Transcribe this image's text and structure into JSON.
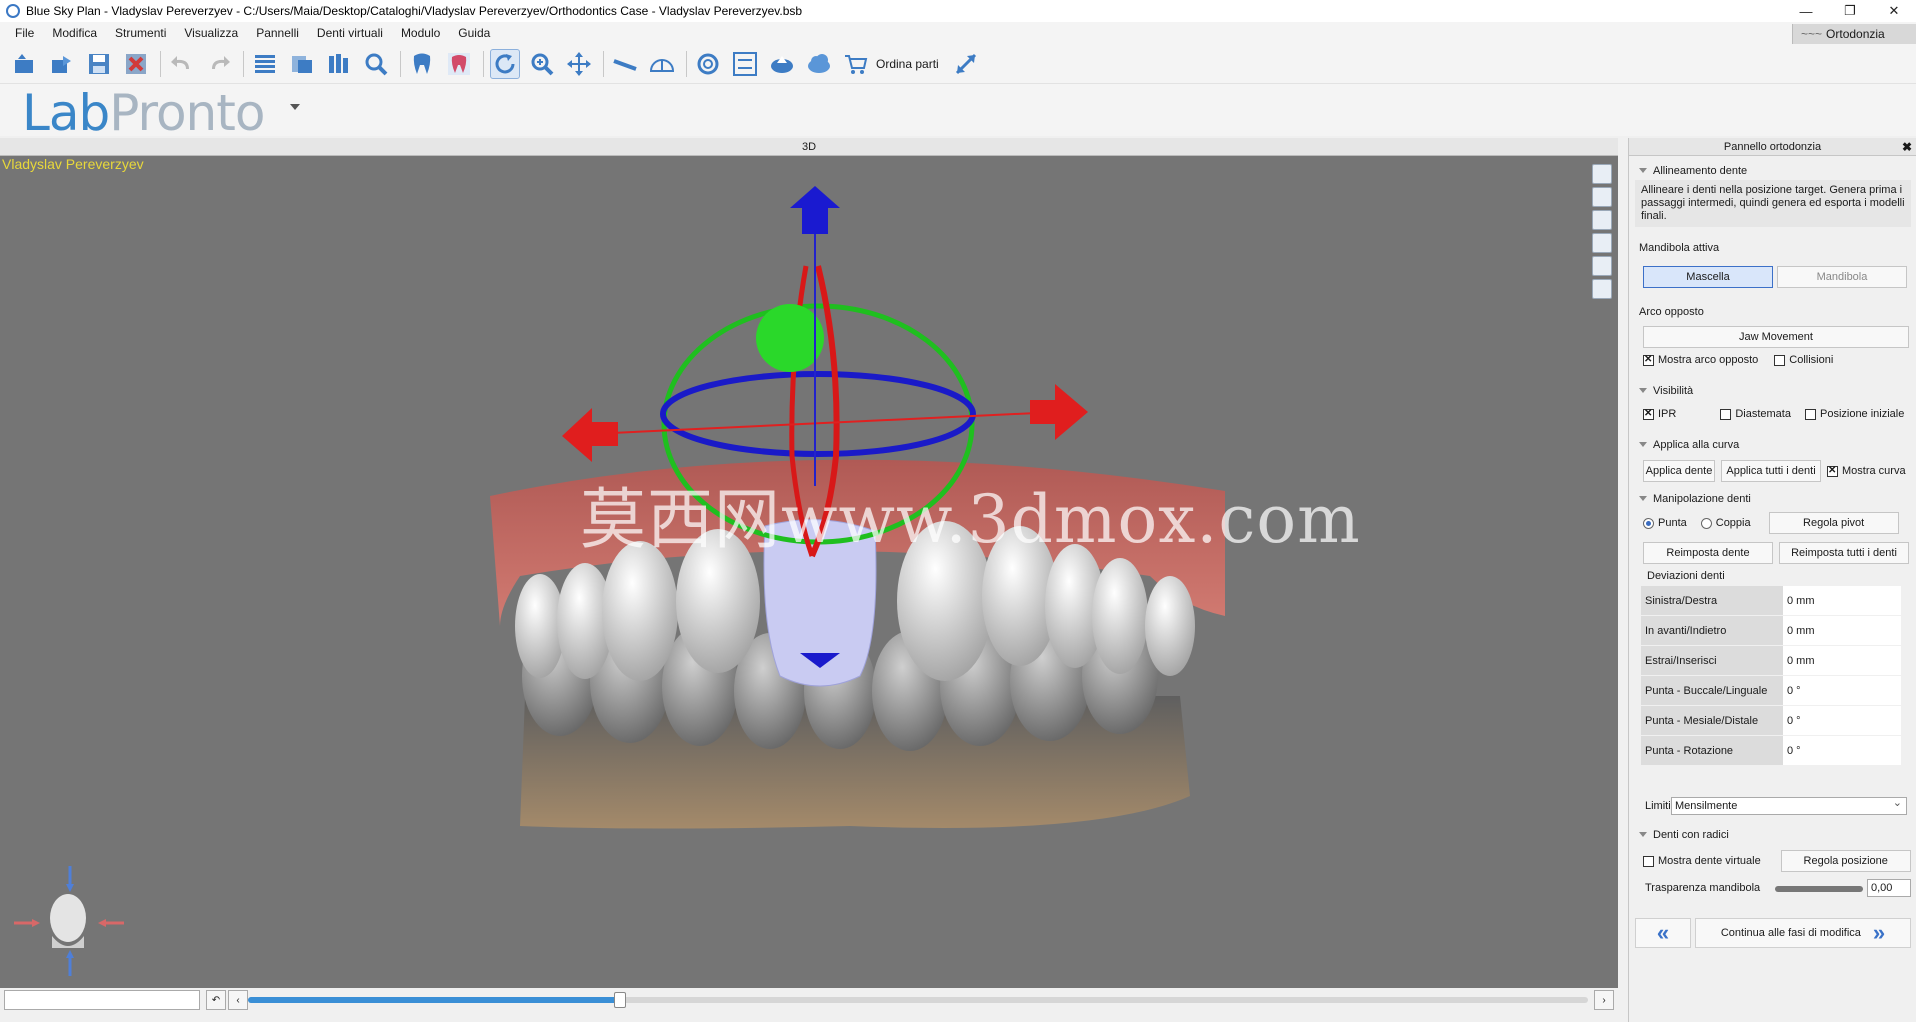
{
  "window": {
    "title": "Blue Sky Plan - Vladyslav Pereverzyev - C:/Users/Maia/Desktop/Cataloghi/Vladyslav Pereverzyev/Orthodontics Case - Vladyslav Pereverzyev.bsb",
    "controls": [
      "—",
      "❐",
      "✕"
    ]
  },
  "menu": {
    "items": [
      "File",
      "Modifica",
      "Strumenti",
      "Visualizza",
      "Pannelli",
      "Denti virtuali",
      "Modulo",
      "Guida"
    ],
    "mode": "Ortodonzia",
    "mode_prefix": "~~~"
  },
  "toolbar": {
    "order_label": "Ordina parti",
    "icons": [
      "open-icon",
      "export-icon",
      "save-icon",
      "close-file-icon",
      "undo-icon",
      "redo-icon",
      "grid-icon",
      "layers-icon",
      "columns-icon",
      "search-icon",
      "tooth-icon",
      "tooth-color-icon",
      "rotate-icon",
      "zoom-icon",
      "pan-icon",
      "ruler-icon",
      "angle-icon",
      "spiral-icon",
      "align-icon",
      "upload-icon",
      "cloud-icon",
      "cart-icon",
      "expand-icon"
    ]
  },
  "logo": {
    "part1": "Lab",
    "part2": "Pronto"
  },
  "viewport": {
    "header": "3D",
    "patient_name": "Vladyslav Pereverzyev",
    "watermark": "莫西网www.3dmox.com"
  },
  "panel": {
    "title": "Pannello ortodonzia",
    "close": "✖",
    "alignment": {
      "heading": "Allineamento dente",
      "description": "Allineare i denti nella posizione target. Genera prima i passaggi intermedi, quindi genera ed esporta i modelli finali."
    },
    "active_jaw": {
      "label": "Mandibola attiva",
      "upper": "Mascella",
      "lower": "Mandibola"
    },
    "opposite_arch": {
      "label": "Arco opposto",
      "jaw_movement": "Jaw Movement",
      "show_opposite": "Mostra arco opposto",
      "collisions": "Collisioni"
    },
    "visibility": {
      "heading": "Visibilità",
      "ipr": "IPR",
      "diastema": "Diastemata",
      "initial_position": "Posizione iniziale"
    },
    "apply_curve": {
      "heading": "Applica alla curva",
      "apply_tooth": "Applica dente",
      "apply_all": "Applica tutti i denti",
      "show_curve": "Mostra curva"
    },
    "manipulation": {
      "heading": "Manipolazione denti",
      "tip": "Punta",
      "torque": "Coppia",
      "adjust_pivot": "Regola pivot",
      "reset_tooth": "Reimposta dente",
      "reset_all": "Reimposta tutti i denti"
    },
    "deviations": {
      "label": "Deviazioni denti",
      "rows": [
        {
          "key": "Sinistra/Destra",
          "value": "0 mm"
        },
        {
          "key": "In avanti/Indietro",
          "value": "0 mm"
        },
        {
          "key": "Estrai/Inserisci",
          "value": "0 mm"
        },
        {
          "key": "Punta - Buccale/Linguale",
          "value": "0 °"
        },
        {
          "key": "Punta - Mesiale/Distale",
          "value": "0 °"
        },
        {
          "key": "Punta - Rotazione",
          "value": "0 °"
        }
      ]
    },
    "limits": {
      "label": "Limiti",
      "value": "Mensilmente"
    },
    "roots": {
      "heading": "Denti con radici",
      "show_virtual": "Mostra dente virtuale",
      "adjust_position": "Regola posizione",
      "transparency_label": "Trasparenza mandibola",
      "transparency_value": "0,00"
    },
    "continue_label": "Continua alle fasi di modifica"
  },
  "colors": {
    "accent": "#3a86c8",
    "viewport_bg": "#757575",
    "patient_text": "#e8d83a"
  }
}
